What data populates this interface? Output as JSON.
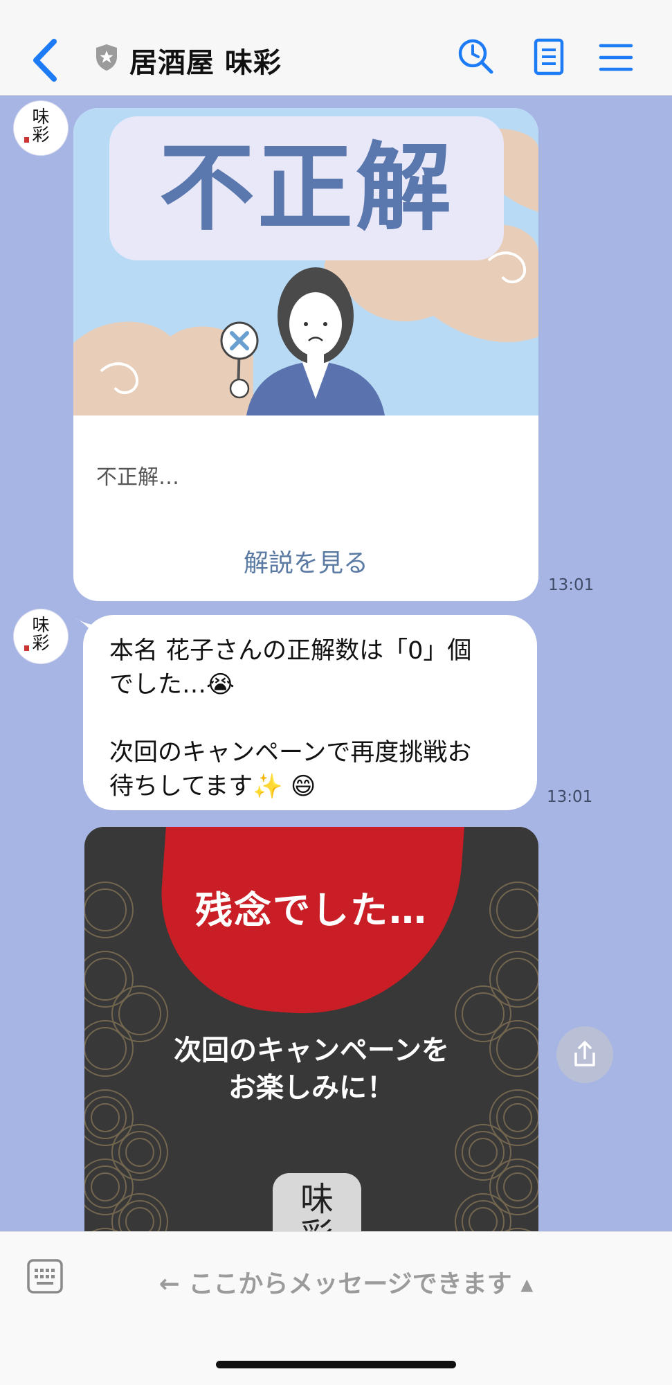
{
  "header": {
    "back_icon": "chevron-left-icon",
    "shield_icon": "shield-icon",
    "title": "居酒屋 味彩",
    "icons": [
      "search-history-icon",
      "notes-icon",
      "menu-icon"
    ],
    "accent_color": "#1d7bf5"
  },
  "chat": {
    "avatar_text": "味\n彩",
    "messages": [
      {
        "type": "card",
        "banner_text": "不正解",
        "text": "不正解…",
        "link": "解説を見る",
        "time": "13:01"
      },
      {
        "type": "text",
        "text": "本名 花子さんの正解数は「0」個\nでした…😭\n\n次回のキャンペーンで再度挑戦お\n待ちしてます✨ 😄",
        "time": "13:01"
      },
      {
        "type": "image",
        "title": "残念でした…",
        "subtitle": "次回のキャンペーンを\nお楽しみに！",
        "logo_text": "味\n彩"
      }
    ],
    "share_icon": "share-icon"
  },
  "footer": {
    "keyboard_icon": "keyboard-icon",
    "hint": "← ここからメッセージできます ▴"
  },
  "colors": {
    "chat_background": "#a6b5e4",
    "banner_text": "#5a78ad",
    "promo_red": "#c91e25",
    "promo_dark": "#393838"
  }
}
